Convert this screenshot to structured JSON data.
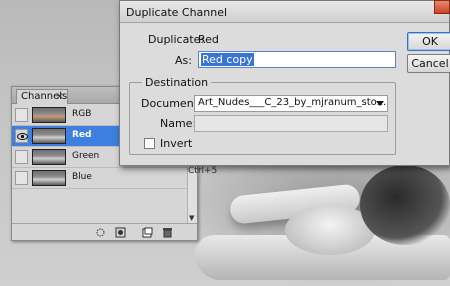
{
  "dialog": {
    "title": "Duplicate Channel",
    "duplicate_label": "Duplicate:",
    "duplicate_value": "Red",
    "as_label": "As:",
    "as_value": "Red copy",
    "destination_label": "Destination",
    "document_label": "Document:",
    "document_value": "Art_Nudes___C_23_by_mjranum_sto...",
    "name_label": "Name:",
    "name_value": "",
    "invert_label": "Invert",
    "invert_checked": false,
    "ok_label": "OK",
    "cancel_label": "Cancel"
  },
  "channels_panel": {
    "tab_label": "Channels",
    "tab_close": "×",
    "channels": [
      {
        "name": "RGB",
        "visible": false,
        "selected": false
      },
      {
        "name": "Red",
        "visible": true,
        "selected": true
      },
      {
        "name": "Green",
        "visible": false,
        "selected": false
      },
      {
        "name": "Blue",
        "visible": false,
        "selected": false
      }
    ],
    "shortcut_partial": "Ctrl+5",
    "footer_icons": [
      "load-selection-icon",
      "save-selection-icon",
      "new-channel-icon",
      "delete-channel-icon"
    ]
  },
  "colors": {
    "selection": "#3d80df",
    "panel_bg": "#d6d6d6",
    "dialog_bg": "#dcdcdc"
  }
}
